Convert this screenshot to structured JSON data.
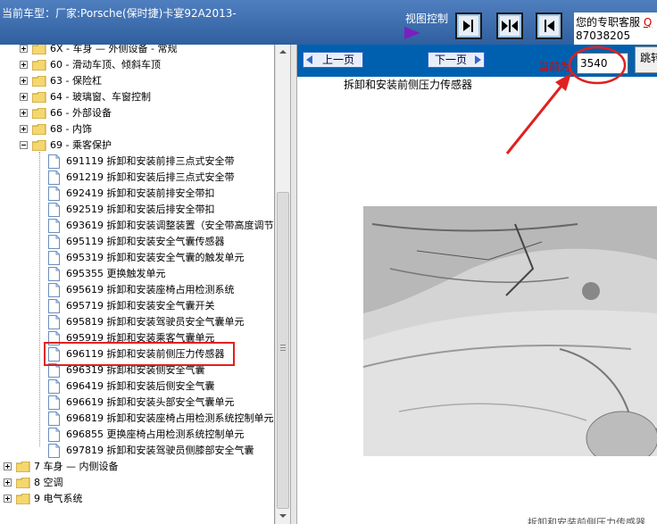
{
  "header": {
    "car_model": "当前车型：厂家:Porsche(保时捷)卡宴92A2013-",
    "view_control_label": "视图控制",
    "service_label": "您的专职客服",
    "service_label_red": "Q",
    "service_phone": "87038205"
  },
  "tree": {
    "items": [
      {
        "label": "6X - 车身 — 外侧设备 - 常规",
        "kind": "folder",
        "expander": "plus"
      },
      {
        "label": "60 - 滑动车顶、倾斜车顶",
        "kind": "folder",
        "expander": "plus"
      },
      {
        "label": "63 - 保险杠",
        "kind": "folder",
        "expander": "plus"
      },
      {
        "label": "64 - 玻璃窗、车窗控制",
        "kind": "folder",
        "expander": "plus"
      },
      {
        "label": "66 - 外部设备",
        "kind": "folder",
        "expander": "plus"
      },
      {
        "label": "68 - 内饰",
        "kind": "folder",
        "expander": "plus"
      },
      {
        "label": "69 - 乘客保护",
        "kind": "folder",
        "expander": "minus"
      },
      {
        "label": "691119 拆卸和安装前排三点式安全带",
        "kind": "doc"
      },
      {
        "label": "691219 拆卸和安装后排三点式安全带",
        "kind": "doc"
      },
      {
        "label": "692419 拆卸和安装前排安全带扣",
        "kind": "doc"
      },
      {
        "label": "692519 拆卸和安装后排安全带扣",
        "kind": "doc"
      },
      {
        "label": "693619 拆卸和安装调整装置（安全带高度调节",
        "kind": "doc"
      },
      {
        "label": "695119 拆卸和安装安全气囊传感器",
        "kind": "doc"
      },
      {
        "label": "695319 拆卸和安装安全气囊的触发单元",
        "kind": "doc"
      },
      {
        "label": "695355 更换触发单元",
        "kind": "doc"
      },
      {
        "label": "695619 拆卸和安装座椅占用检测系统",
        "kind": "doc"
      },
      {
        "label": "695719 拆卸和安装安全气囊开关",
        "kind": "doc"
      },
      {
        "label": "695819 拆卸和安装驾驶员安全气囊单元",
        "kind": "doc"
      },
      {
        "label": "695919 拆卸和安装乘客气囊单元",
        "kind": "doc"
      },
      {
        "label": "696119 拆卸和安装前侧压力传感器",
        "kind": "doc",
        "selected": true
      },
      {
        "label": "696319 拆卸和安装侧安全气囊",
        "kind": "doc"
      },
      {
        "label": "696419 拆卸和安装后侧安全气囊",
        "kind": "doc"
      },
      {
        "label": "696619 拆卸和安装头部安全气囊单元",
        "kind": "doc"
      },
      {
        "label": "696819 拆卸和安装座椅占用检测系统控制单元",
        "kind": "doc"
      },
      {
        "label": "696855 更换座椅占用检测系统控制单元",
        "kind": "doc"
      },
      {
        "label": "697819 拆卸和安装驾驶员侧膝部安全气囊",
        "kind": "doc"
      },
      {
        "label": "7 车身 — 内侧设备",
        "kind": "folder",
        "expander": "plus",
        "level": 0
      },
      {
        "label": "8 空调",
        "kind": "folder",
        "expander": "plus",
        "level": 0
      },
      {
        "label": "9 电气系统",
        "kind": "folder",
        "expander": "plus",
        "level": 0
      }
    ]
  },
  "pager": {
    "prev_label": "上一页",
    "next_label": "下一页",
    "current_label": "当前为",
    "current_page": "3540",
    "jump_label": "跳转"
  },
  "document": {
    "title": "拆卸和安装前侧压力传感器",
    "bottom_text": "拆卸和安装前侧压力传感器"
  },
  "colors": {
    "header_bg": "#3f6faf",
    "toolbar_bg": "#0060b0",
    "annotation_red": "#e02020"
  }
}
